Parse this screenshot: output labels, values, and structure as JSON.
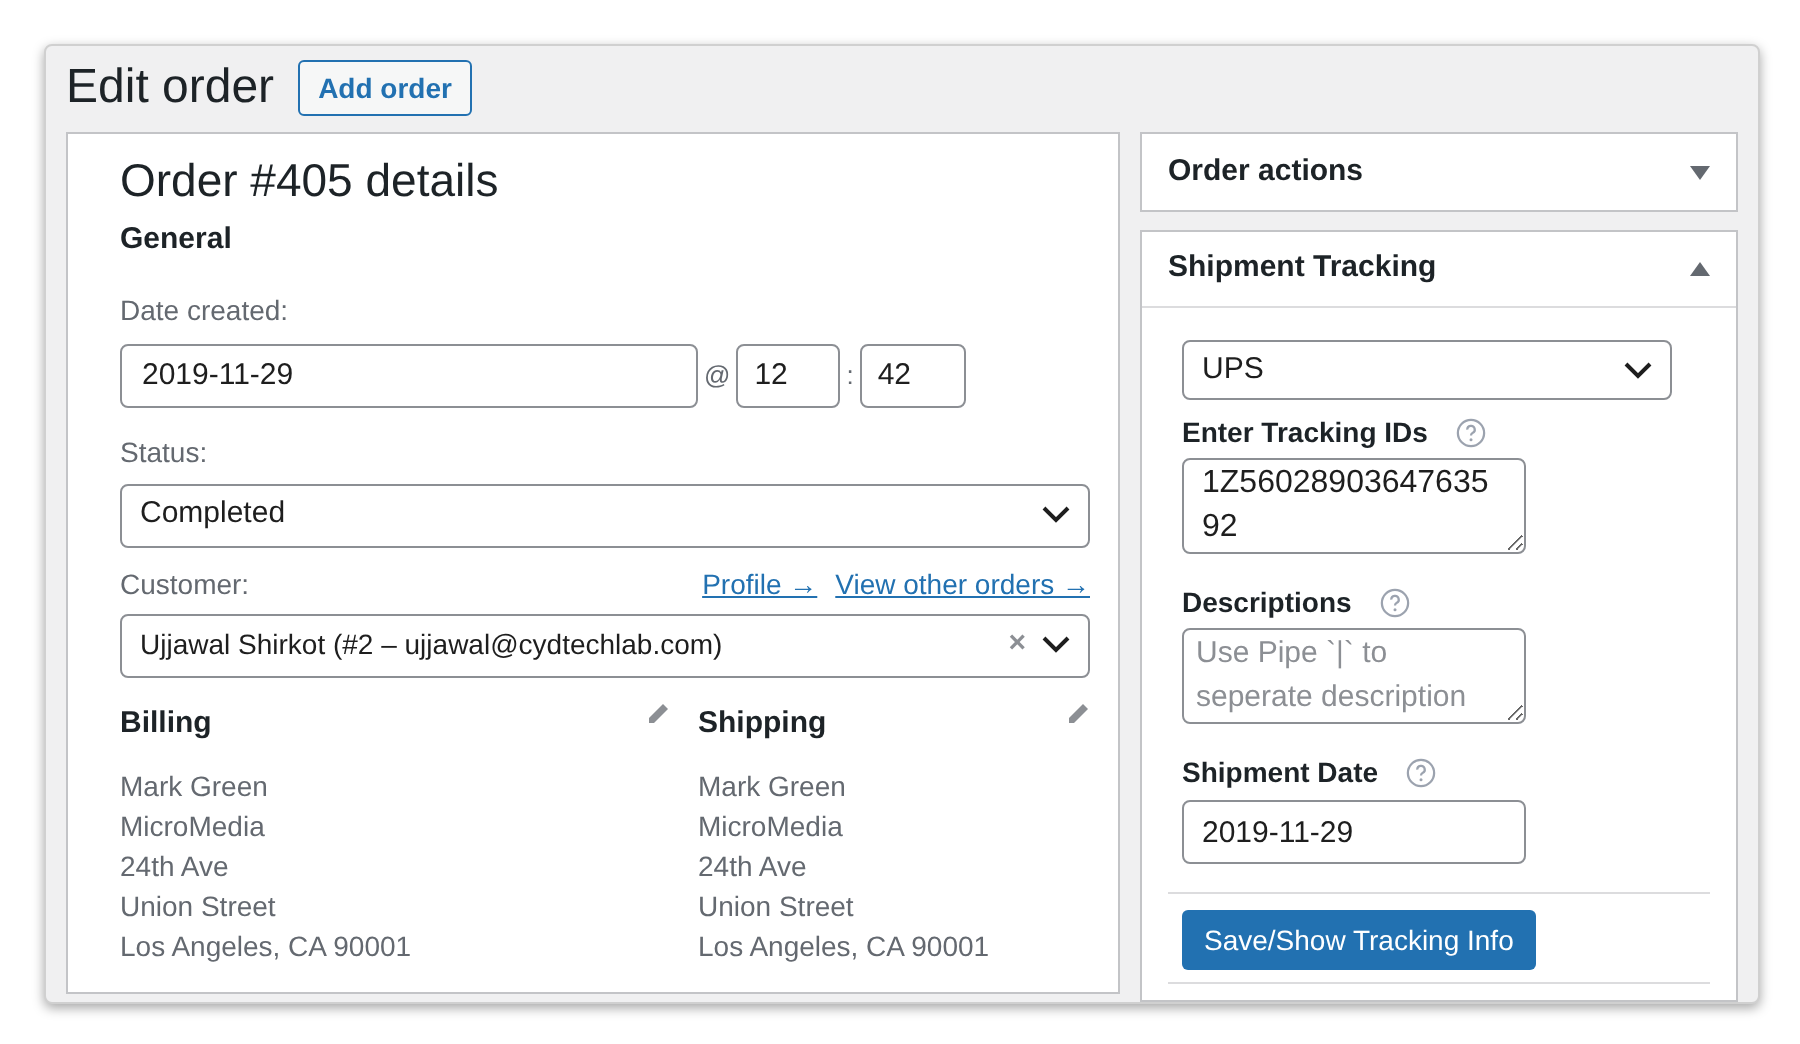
{
  "header": {
    "title": "Edit order",
    "add_button": "Add order"
  },
  "order": {
    "title": "Order #405 details",
    "section": "General",
    "date_label": "Date created:",
    "date": "2019-11-29",
    "at": "@",
    "hour": "12",
    "colon": ":",
    "minute": "42",
    "status_label": "Status:",
    "status": "Completed",
    "customer_label": "Customer:",
    "customer_links": [
      "Profile →",
      "View other orders →"
    ],
    "customer": "Ujjawal Shirkot (#2 – ujjawal@cydtechlab.com)",
    "clear": "×",
    "addresses": [
      {
        "title": "Billing",
        "lines": [
          "Mark Green",
          "MicroMedia",
          "24th Ave",
          "Union Street",
          "Los Angeles, CA 90001"
        ]
      },
      {
        "title": "Shipping",
        "lines": [
          "Mark Green",
          "MicroMedia",
          "24th Ave",
          "Union Street",
          "Los Angeles, CA 90001"
        ]
      }
    ]
  },
  "sidebar": [
    {
      "title": "Order actions",
      "expanded": false
    },
    {
      "title": "Shipment Tracking",
      "expanded": true
    }
  ],
  "tracking": {
    "carrier": "UPS",
    "ids_label": "Enter Tracking IDs",
    "ids": "1Z5602890364763592",
    "desc_label": "Descriptions",
    "desc_placeholder": "Use Pipe `|` to seperate description",
    "date_label": "Shipment Date",
    "date": "2019-11-29",
    "save_button": "Save/Show Tracking Info"
  }
}
